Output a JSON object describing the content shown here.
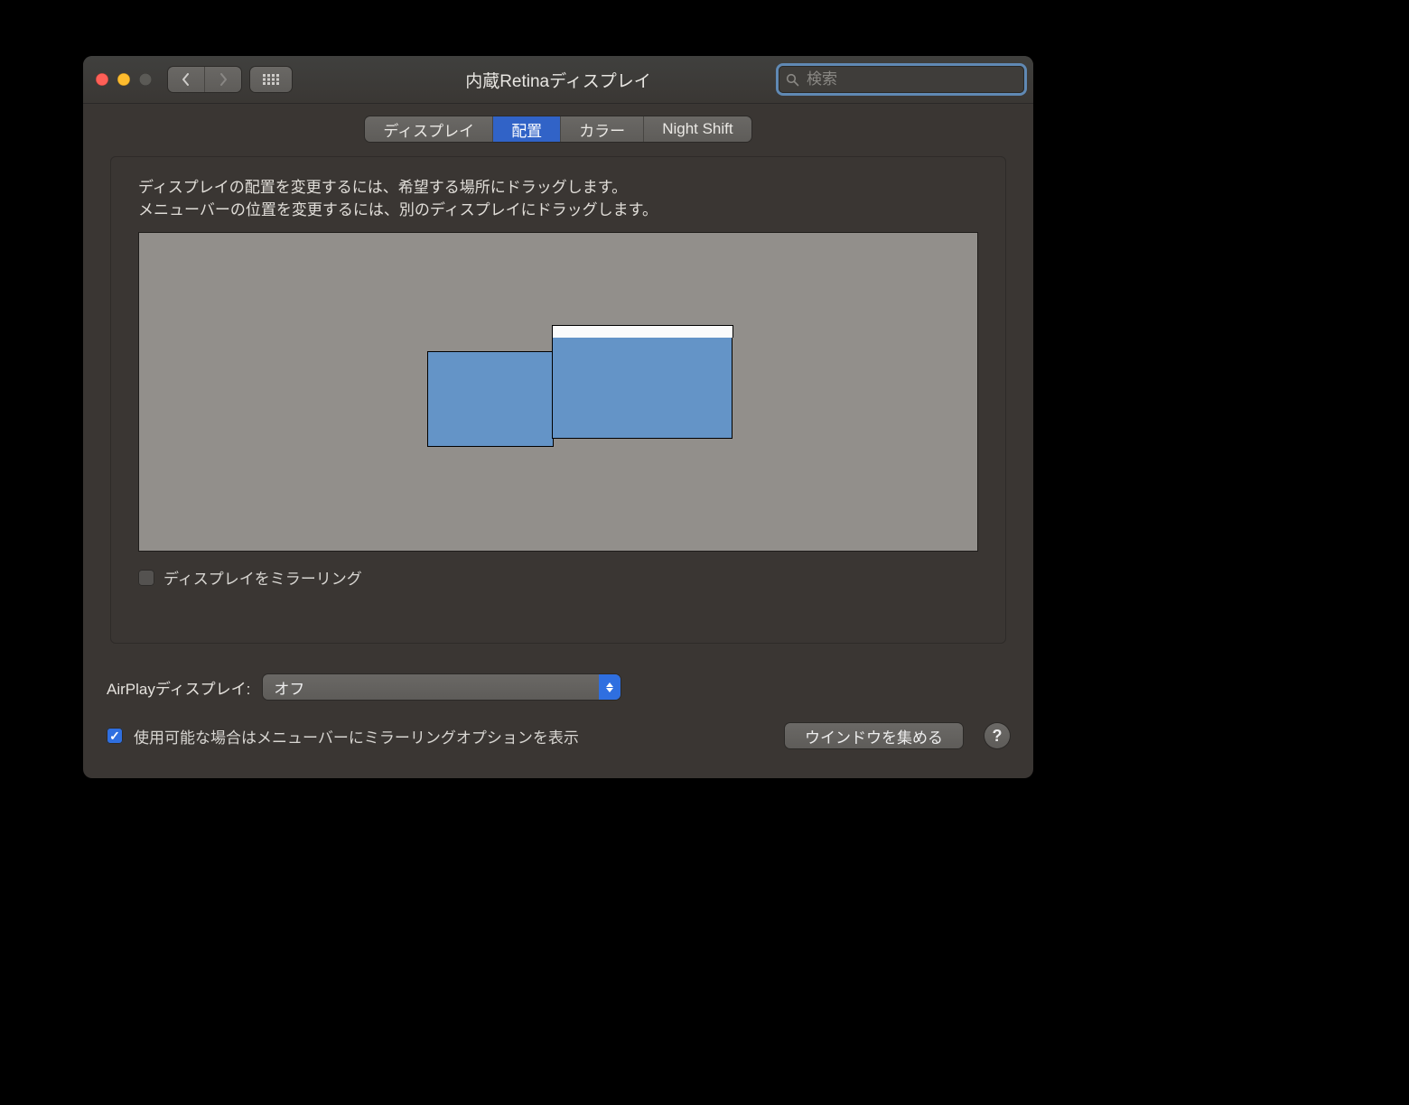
{
  "window_title": "内蔵Retinaディスプレイ",
  "search_placeholder": "検索",
  "tabs": {
    "display": "ディスプレイ",
    "arrangement": "配置",
    "color": "カラー",
    "night_shift": "Night Shift"
  },
  "instructions": {
    "line1": "ディスプレイの配置を変更するには、希望する場所にドラッグします。",
    "line2": "メニューバーの位置を変更するには、別のディスプレイにドラッグします。"
  },
  "mirror_label": "ディスプレイをミラーリング",
  "airplay": {
    "label": "AirPlayディスプレイ:",
    "value": "オフ"
  },
  "show_mirroring_label": "使用可能な場合はメニューバーにミラーリングオプションを表示",
  "gather_windows_label": "ウインドウを集める",
  "help_label": "?"
}
